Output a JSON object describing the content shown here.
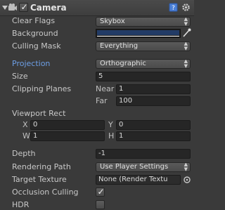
{
  "component": {
    "title": "Camera",
    "enabled": true
  },
  "colors": {
    "background_swatch": "#223b66",
    "selected_label": "#6d9fe6",
    "panel": "#3a3a3a"
  },
  "fields": {
    "clear_flags": {
      "label": "Clear Flags",
      "value": "Skybox"
    },
    "background": {
      "label": "Background"
    },
    "culling_mask": {
      "label": "Culling Mask",
      "value": "Everything"
    },
    "projection": {
      "label": "Projection",
      "value": "Orthographic"
    },
    "size": {
      "label": "Size",
      "value": "5"
    },
    "clipping_planes": {
      "label": "Clipping Planes",
      "near_label": "Near",
      "near_value": "1",
      "far_label": "Far",
      "far_value": "100"
    },
    "viewport_rect": {
      "label": "Viewport Rect",
      "x_label": "X",
      "x_value": "0",
      "y_label": "Y",
      "y_value": "0",
      "w_label": "W",
      "w_value": "1",
      "h_label": "H",
      "h_value": "1"
    },
    "depth": {
      "label": "Depth",
      "value": "-1"
    },
    "rendering_path": {
      "label": "Rendering Path",
      "value": "Use Player Settings"
    },
    "target_texture": {
      "label": "Target Texture",
      "value": "None (Render Textu"
    },
    "occlusion_culling": {
      "label": "Occlusion Culling",
      "checked": true
    },
    "hdr": {
      "label": "HDR",
      "checked": false
    }
  }
}
